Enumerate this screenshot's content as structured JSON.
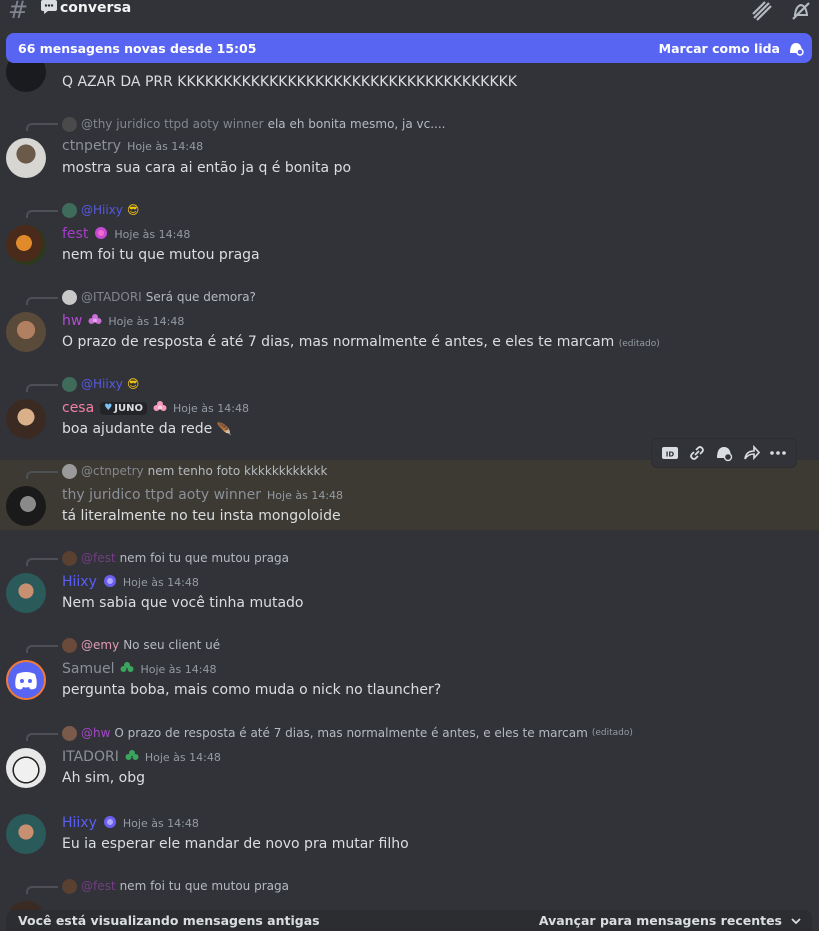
{
  "header": {
    "channel": "conversa"
  },
  "new_messages_bar": {
    "text": "66 mensagens novas desde 15:05",
    "action": "Marcar como lida"
  },
  "messages": [
    {
      "username": "",
      "time": "",
      "body": "Q AZAR DA PRR KKKKKKKKKKKKKKKKKKKKKKKKKKKKKKKKKKKKK"
    },
    {
      "reply_name": "@thy juridico ttpd aoty winner",
      "reply_text": "ela eh bonita mesmo, ja vc....",
      "username": "ctnpetry",
      "time": "Hoje às 14:48",
      "body": "mostra sua cara ai então ja q é bonita po"
    },
    {
      "reply_name": "@Hiixy",
      "reply_text": "",
      "username": "fest",
      "time": "Hoje às 14:48",
      "body": "nem foi tu que mutou praga"
    },
    {
      "reply_name": "@ITADORI",
      "reply_text": "Será que demora?",
      "username": "hw",
      "time": "Hoje às 14:48",
      "body": "O prazo de resposta é até 7 dias, mas normalmente é antes, e eles te marcam",
      "edited": "(editado)"
    },
    {
      "reply_name": "@Hiixy",
      "reply_text": "",
      "username": "cesa",
      "badge": "JUNO",
      "time": "Hoje às 14:48",
      "body": "boa ajudante da rede"
    },
    {
      "reply_name": "@ctnpetry",
      "reply_text": "nem tenho foto kkkkkkkkkkkk",
      "username": "thy juridico ttpd aoty winner",
      "time": "Hoje às 14:48",
      "body": "tá literalmente no teu insta mongoloide"
    },
    {
      "reply_name": "@fest",
      "reply_text": "nem foi tu que mutou praga",
      "username": "Hiixy",
      "time": "Hoje às 14:48",
      "body": "Nem sabia que você tinha mutado"
    },
    {
      "reply_name": "@emy",
      "reply_text": "No seu client ué",
      "username": "Samuel",
      "time": "Hoje às 14:48",
      "body": "pergunta boba, mais como muda o nick no tlauncher?"
    },
    {
      "reply_name": "@hw",
      "reply_text": "O prazo de resposta é até 7 dias, mas normalmente é antes, e eles te marcam",
      "reply_edited": "(editado)",
      "username": "ITADORI",
      "time": "Hoje às 14:48",
      "body": "Ah sim, obg"
    },
    {
      "username": "Hiixy",
      "time": "Hoje às 14:48",
      "body": "Eu ia esperar ele mandar de novo pra mutar filho"
    },
    {
      "reply_name": "@fest",
      "reply_text": "nem foi tu que mutou praga"
    }
  ],
  "bottom_bar": {
    "text": "Você está visualizando mensagens antigas",
    "action": "Avançar para mensagens recentes"
  },
  "colors": {
    "accent": "#5865f2",
    "fest": "#a33fc7",
    "hw": "#b24ad6",
    "cesa": "#f47fa4",
    "hiixy": "#5a5ef5",
    "gray_name": "#8c9098",
    "emy": "#f2a7c0"
  }
}
